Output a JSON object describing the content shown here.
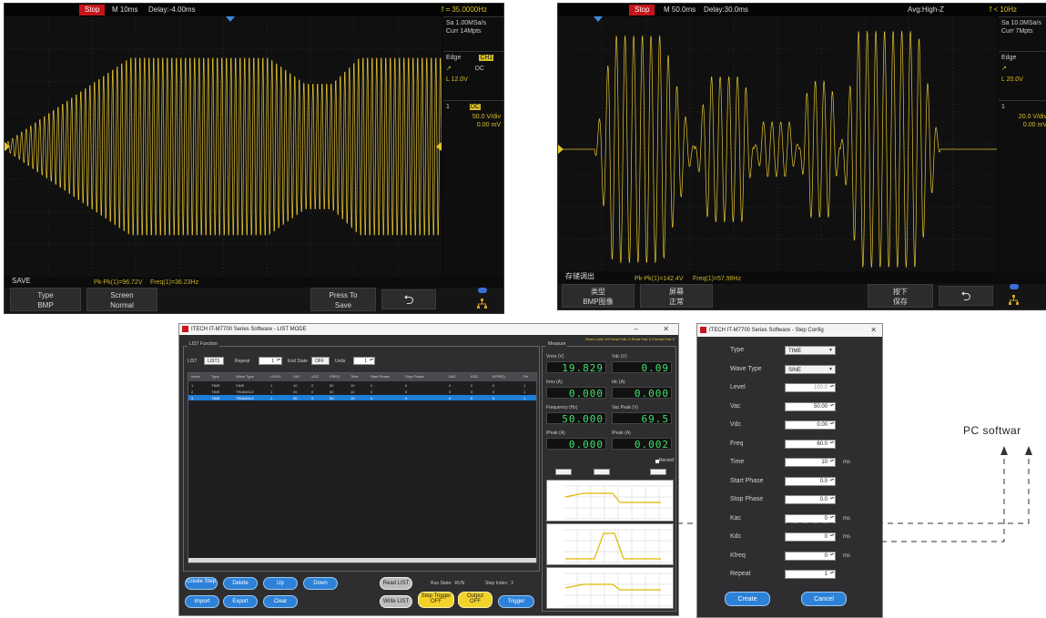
{
  "scope1": {
    "stop_badge": "Stop",
    "timebase": "M 10ms",
    "delay": "Delay:-4.00ms",
    "trigger_freq": "f = 35.0000Hz",
    "sample_rate": "Sa 1.00MSa/s",
    "curr": "Curr 14Mpts",
    "trig_title": "Edge",
    "trig_src": "CH1",
    "trig_coupling": "DC",
    "trig_level": "L 12.0V",
    "ch_num": "1",
    "ch_coupling": "DC",
    "ch_scale": "50.0 V/div",
    "ch_offset": "0.00 mV",
    "save_label": "SAVE",
    "meas1": "Pk-Pk(1)=96.72V",
    "meas2": "Freq(1)=36.23Hz",
    "menu": [
      {
        "line1": "Type",
        "line2": "BMP"
      },
      {
        "line1": "Screen",
        "line2": "Normal"
      },
      {
        "line1": "Press To",
        "line2": "Save"
      }
    ],
    "back_symbol": "⮌"
  },
  "scope2": {
    "stop_badge": "Stop",
    "timebase": "M 50.0ms",
    "delay": "Delay:30.0ms",
    "acq": "Avg:High-Z",
    "trigger_freq": "f < 10Hz",
    "sample_rate": "Sa 10.0MSa/s",
    "curr": "Curr 7Mpts",
    "trig_title": "Edge",
    "trig_level": "L 20.0V",
    "ch_num": "1",
    "ch_scale": "20.0 V/div",
    "ch_offset": "0.00 mV",
    "save_label": "存储调出",
    "meas1": "Pk-Pk(1)=142.4V",
    "meas2": "Freq(1)=57.98Hz",
    "menu": [
      {
        "line1": "类型",
        "line2": "BMP图像"
      },
      {
        "line1": "屏幕",
        "line2": "正常"
      },
      {
        "line1": "按下",
        "line2": "保存"
      }
    ],
    "back_symbol": "⮌"
  },
  "list_window": {
    "title": "ITECH IT-M7700 Series Software - LIST MODE",
    "status_right": "Read Limit: 3/3  Read Fail: 0  Read Fail: 0  Format Fail: 0",
    "group_title": "LIST Function",
    "list_label": "LIST",
    "list_value": "LIST1",
    "repeat_label": "Repeat",
    "repeat_value": "1",
    "end_state_label": "End State",
    "end_state_value": "OFF",
    "units_label": "Units",
    "units_value": "1",
    "columns": [
      "Index",
      "Type",
      "Wave Type",
      "LEVEL",
      "VAC",
      "VDC",
      "FREQ",
      "Time",
      "Start Phase",
      "Stop Phase",
      "KAC",
      "KDC",
      "KFREQ",
      "Re"
    ],
    "rows": [
      [
        "1",
        "TIME",
        "SINE",
        "1",
        "10",
        "0",
        "50",
        "10",
        "0",
        "0",
        "0",
        "0",
        "0",
        "1"
      ],
      [
        "2",
        "TIME",
        "TRIANGLE",
        "1",
        "20",
        "0",
        "50",
        "10",
        "0",
        "0",
        "0",
        "0",
        "0",
        "1"
      ],
      [
        "3",
        "TIME",
        "TRIANGLE",
        "1",
        "30",
        "0",
        "50",
        "10",
        "0",
        "0",
        "0",
        "0",
        "0",
        "1"
      ]
    ],
    "buttons_row1": [
      "Create Step",
      "Delete",
      "Up",
      "Down"
    ],
    "buttons_row2": [
      "Import",
      "Export",
      "Clear"
    ],
    "read_list": "Read LIST",
    "write_list": "Write LIST",
    "run_state": "Run State:  RUN",
    "step_index": "Step Index:  3",
    "step_trigger": "Step Trigger\nOFF",
    "output": "Output\nOFF",
    "trigger": "Trigger",
    "measure_title": "Measure",
    "meas_labels": [
      "Vrms (V)",
      "Irms (A)",
      "Frequency (Hz)",
      "IPeak (A)",
      "Vdc (V)",
      "Idc (A)",
      "Vac Peak (V)",
      "IPeak (A)"
    ],
    "meas_values": [
      "19.829",
      "0.000",
      "50.000",
      "0.000",
      "0.09",
      "0.000",
      "69.5",
      "0.002"
    ],
    "record_label": "Record",
    "plot_titles": [
      "Vrms",
      "Irms",
      "Freq"
    ]
  },
  "step_window": {
    "title": "ITECH IT-M7700 Series Software - Step Config",
    "close_symbol": "✕",
    "fields": [
      {
        "label": "Type",
        "kind": "combo",
        "value": "TIME",
        "unit": ""
      },
      {
        "label": "Wave Type",
        "kind": "combo",
        "value": "SINE",
        "unit": ""
      },
      {
        "label": "Level",
        "kind": "spin",
        "value": "100.0",
        "unit": ""
      },
      {
        "label": "Vac",
        "kind": "spin",
        "value": "50.00",
        "unit": ""
      },
      {
        "label": "Vdc",
        "kind": "spin",
        "value": "0.00",
        "unit": ""
      },
      {
        "label": "Freq",
        "kind": "spin",
        "value": "60.0",
        "unit": ""
      },
      {
        "label": "Time",
        "kind": "spin",
        "value": "10",
        "unit": "ms"
      },
      {
        "label": "Start Phase",
        "kind": "spin",
        "value": "0.0",
        "unit": ""
      },
      {
        "label": "Stop Phase",
        "kind": "spin",
        "value": "0.0",
        "unit": ""
      },
      {
        "label": "Kac",
        "kind": "spin",
        "value": "0",
        "unit": "ms"
      },
      {
        "label": "Kdc",
        "kind": "spin",
        "value": "0",
        "unit": "ms"
      },
      {
        "label": "Kfreq",
        "kind": "spin",
        "value": "0",
        "unit": "ms"
      },
      {
        "label": "Repeat",
        "kind": "spin",
        "value": "1",
        "unit": ""
      }
    ],
    "create": "Create",
    "cancel": "Cancel"
  },
  "callout": {
    "text": "PC softwar"
  },
  "colors": {
    "trace": "#e6c530",
    "stop": "#c8141c",
    "accent": "#2d82d8",
    "segment": "#3ee36a"
  }
}
